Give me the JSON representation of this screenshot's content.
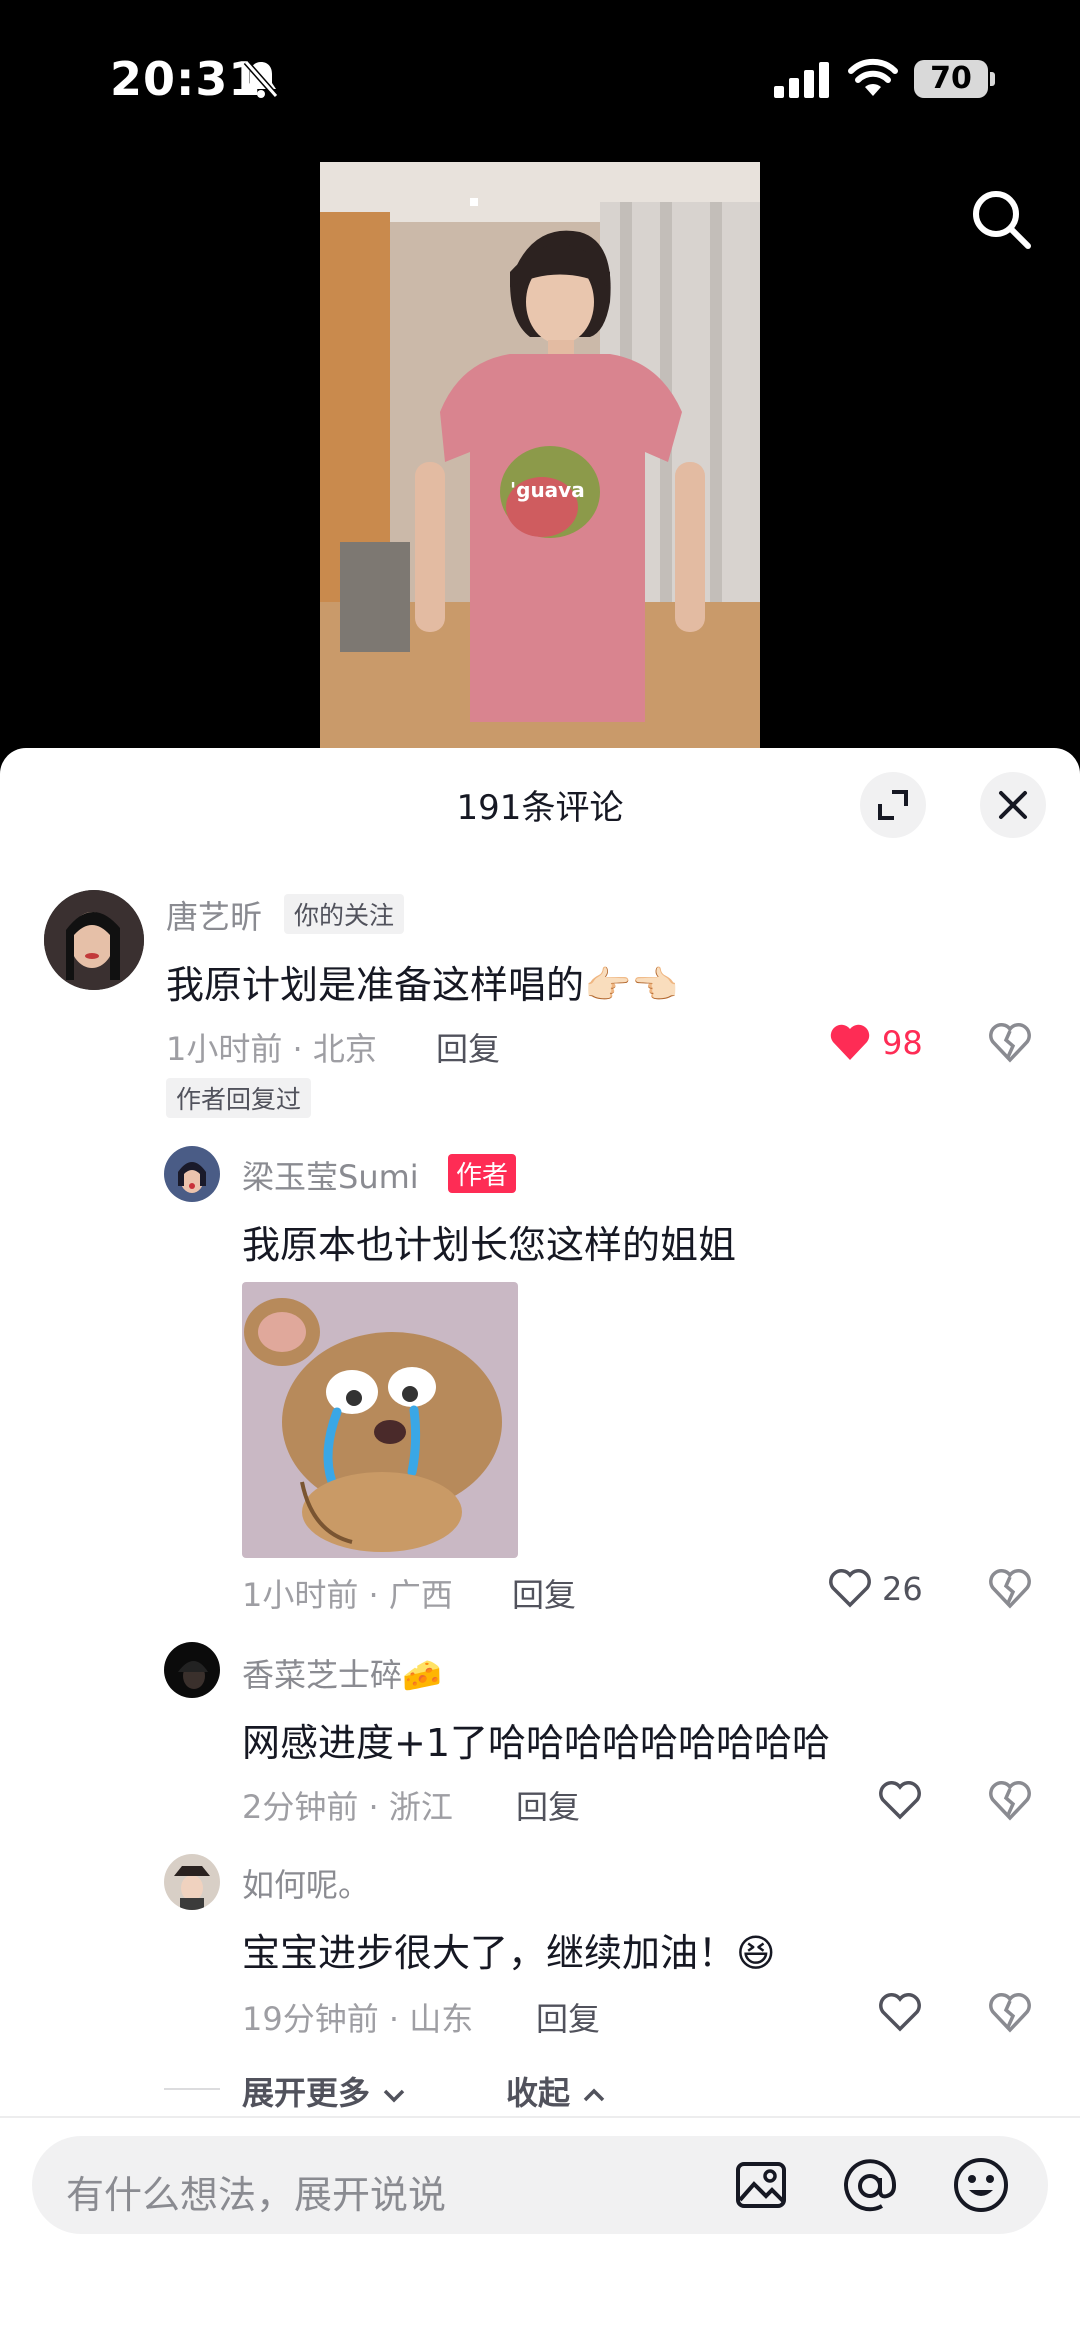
{
  "status_bar": {
    "time": "20:31",
    "battery": "70"
  },
  "comments_panel": {
    "title": "191条评论",
    "input_placeholder": "有什么想法，展开说说",
    "expand_more": "展开更多",
    "collapse": "收起"
  },
  "comments": [
    {
      "username": "唐艺昕",
      "tag": "你的关注",
      "text": "我原计划是准备这样唱的👉🏻👈🏻",
      "meta": "1小时前 · 北京",
      "reply_label": "回复",
      "likes": "98",
      "liked": true,
      "author_replied_tag": "作者回复过"
    }
  ],
  "replies": [
    {
      "username": "梁玉莹Sumi",
      "author_tag": "作者",
      "text": "我原本也计划长您这样的姐姐",
      "meta": "1小时前 · 广西",
      "reply_label": "回复",
      "likes": "26",
      "image_description": "crying-jerry-sticker"
    },
    {
      "username": "香菜芝士碎🧀",
      "text": "网感进度+1了哈哈哈哈哈哈哈哈哈",
      "meta": "2分钟前 · 浙江",
      "reply_label": "回复",
      "likes": ""
    },
    {
      "username": "如何呢。",
      "text": "宝宝进步很大了，继续加油！😆",
      "meta": "19分钟前 · 山东",
      "reply_label": "回复",
      "likes": ""
    }
  ],
  "colors": {
    "accent_red": "#fe2c55",
    "panel_bg": "#ffffff",
    "text": "#161823",
    "muted": "#8a8b91"
  }
}
